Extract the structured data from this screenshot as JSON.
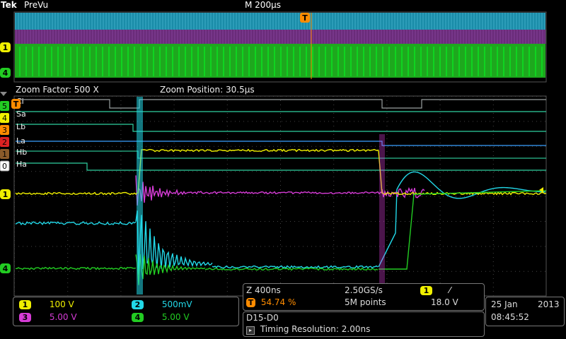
{
  "header": {
    "brand": "Tek",
    "mode": "PreVu",
    "timebase": "M 200µs"
  },
  "zoom": {
    "factor_label": "Zoom Factor: 500 X",
    "position_label": "Zoom Position: 30.5µs"
  },
  "digital_labels": [
    "Ci",
    "Sa",
    "Lb",
    "La",
    "Hb",
    "Ha"
  ],
  "channel_markers": [
    "5",
    "4",
    "3",
    "2",
    "1",
    "0"
  ],
  "analog_markers": {
    "ch1": "1",
    "ch4": "4",
    "trigger": "T"
  },
  "channels": [
    {
      "num": "1",
      "scale": "100 V",
      "color": "#f0f000"
    },
    {
      "num": "2",
      "scale": "500mV",
      "color": "#22d8e8"
    },
    {
      "num": "3",
      "scale": "5.00 V",
      "color": "#d63cd6"
    },
    {
      "num": "4",
      "scale": "5.00 V",
      "color": "#22cc22"
    }
  ],
  "acquisition": {
    "zoom_time": "Z 400ns",
    "sample_rate": "2.50GS/s",
    "trigger_source": "1",
    "trigger_slope": "⁄",
    "trigger_pos": "54.74 %",
    "record_length": "5M points",
    "trigger_level": "18.0 V"
  },
  "bus": {
    "name": "D15-D0",
    "timing": "Timing Resolution: 2.00ns"
  },
  "datetime": {
    "date": "25 Jan",
    "year": "2013",
    "time": "08:45:52"
  }
}
